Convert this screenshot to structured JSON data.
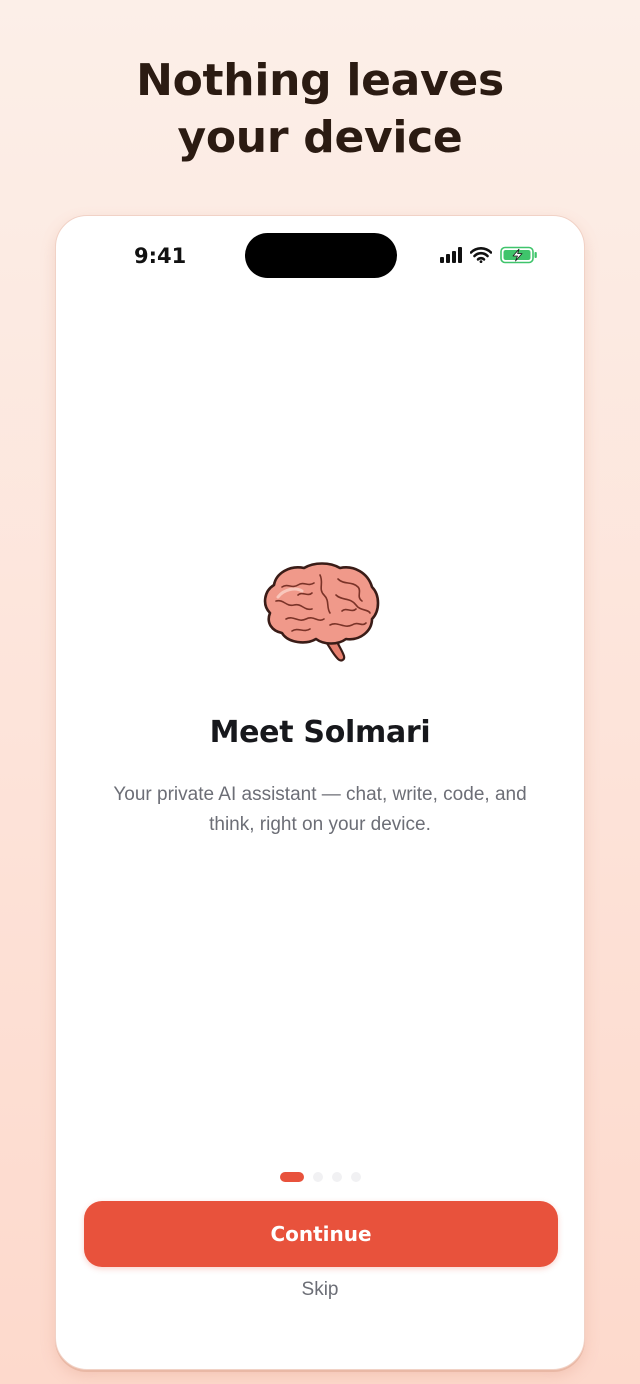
{
  "headline": {
    "line1": "Nothing leaves",
    "line2": "your device"
  },
  "status_bar": {
    "time": "9:41",
    "battery_color": "#3fc46b"
  },
  "onboarding": {
    "title": "Meet Solmari",
    "subtitle": "Your private AI assistant — chat, write, code, and think, right on your device.",
    "illustration": "brain-icon",
    "page_indicator": {
      "current": 1,
      "total": 4
    }
  },
  "actions": {
    "continue_label": "Continue",
    "skip_label": "Skip"
  },
  "colors": {
    "accent": "#e8523c",
    "background": "#fde3d9"
  }
}
